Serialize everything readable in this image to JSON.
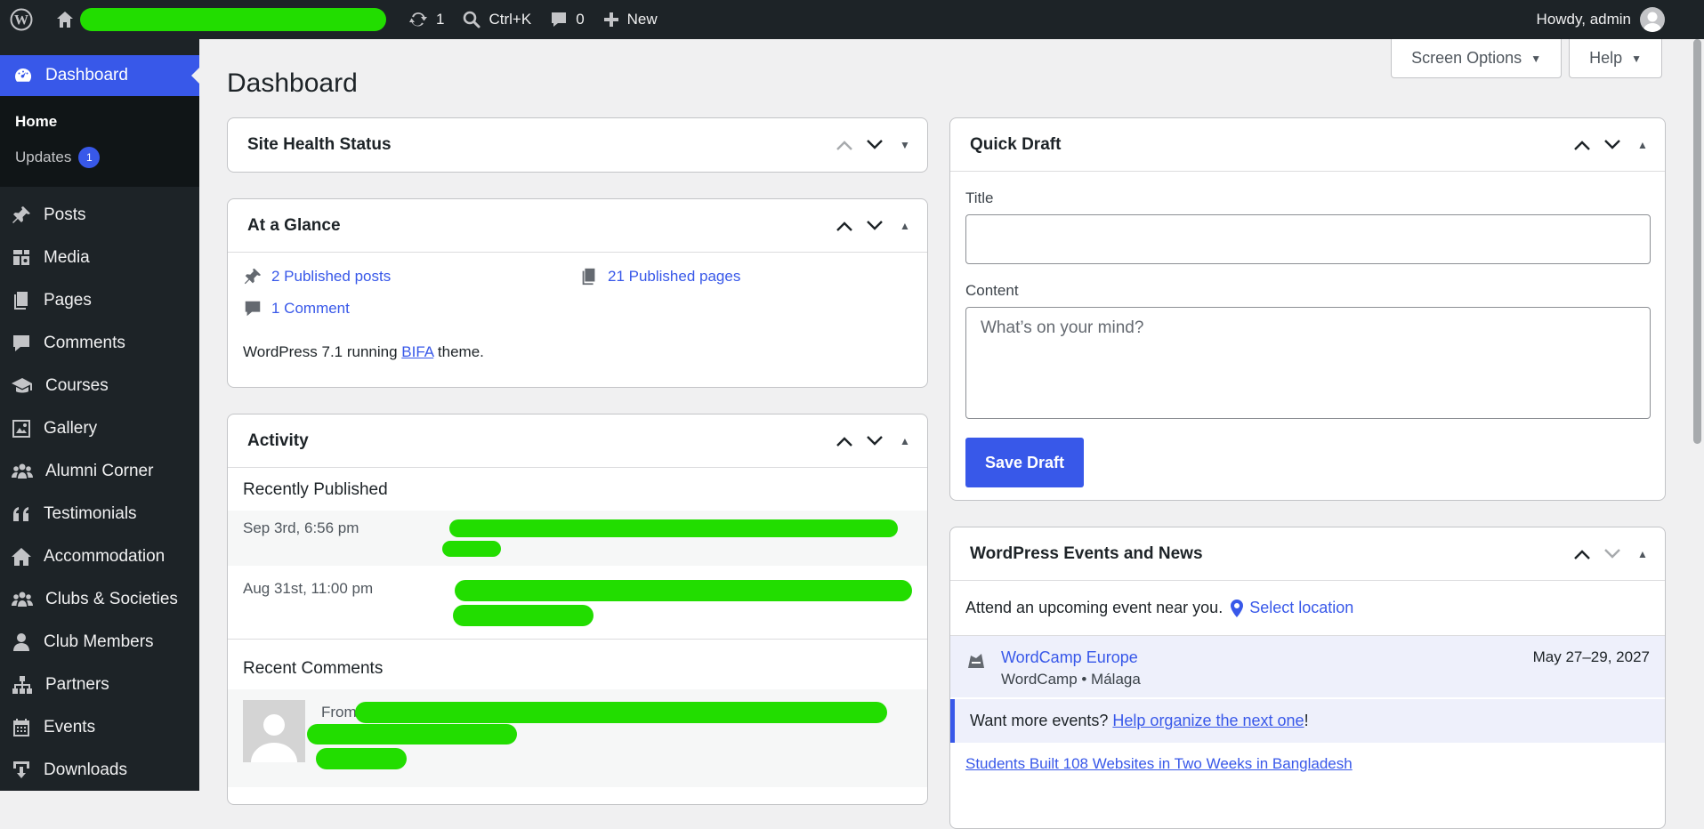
{
  "adminbar": {
    "updates_count": "1",
    "search_label": "Ctrl+K",
    "comments_count": "0",
    "new_label": "New",
    "howdy": "Howdy, admin"
  },
  "sidebar": {
    "dashboard_label": "Dashboard",
    "submenu": {
      "home": "Home",
      "updates": "Updates",
      "updates_count": "1"
    },
    "items": [
      {
        "label": "Posts",
        "icon": "pushpin-icon"
      },
      {
        "label": "Media",
        "icon": "media-icon"
      },
      {
        "label": "Pages",
        "icon": "pages-icon"
      },
      {
        "label": "Comments",
        "icon": "comment-icon"
      },
      {
        "label": "Courses",
        "icon": "graduation-cap-icon"
      },
      {
        "label": "Gallery",
        "icon": "gallery-icon"
      },
      {
        "label": "Alumni Corner",
        "icon": "groups-icon"
      },
      {
        "label": "Testimonials",
        "icon": "quote-icon"
      },
      {
        "label": "Accommodation",
        "icon": "home-icon"
      },
      {
        "label": "Clubs & Societies",
        "icon": "groups-icon"
      },
      {
        "label": "Club Members",
        "icon": "user-icon"
      },
      {
        "label": "Partners",
        "icon": "networking-icon"
      },
      {
        "label": "Events",
        "icon": "calendar-icon"
      },
      {
        "label": "Downloads",
        "icon": "download-icon"
      }
    ]
  },
  "main": {
    "screen_options": "Screen Options",
    "help": "Help",
    "title": "Dashboard"
  },
  "site_health": {
    "title": "Site Health Status"
  },
  "glance": {
    "title": "At a Glance",
    "posts": "2 Published posts",
    "pages": "21 Published pages",
    "comments": "1 Comment",
    "version_prefix": "WordPress 7.1 running ",
    "theme": "BIFA",
    "version_suffix": " theme."
  },
  "activity": {
    "title": "Activity",
    "recently_published": "Recently Published",
    "rows": [
      {
        "date": "Sep 3rd, 6:56 pm"
      },
      {
        "date": "Aug 31st, 11:00 pm"
      }
    ],
    "recent_comments": "Recent Comments",
    "comment_from": "From"
  },
  "quick_draft": {
    "title": "Quick Draft",
    "title_label": "Title",
    "content_label": "Content",
    "content_placeholder": "What’s on your mind?",
    "save_label": "Save Draft"
  },
  "events": {
    "title": "WordPress Events and News",
    "intro": "Attend an upcoming event near you.",
    "select_location": "Select location",
    "event_title": "WordCamp Europe",
    "event_sub": "WordCamp • Málaga",
    "event_date": "May 27–29, 2027",
    "more_prefix": "Want more events? ",
    "more_link": "Help organize the next one",
    "more_suffix": "!",
    "news_link": "Students Built 108 Websites in Two Weeks in Bangladesh"
  },
  "colors": {
    "accent": "#3858e9",
    "redaction": "#22dd00",
    "adminbar": "#1d2327"
  }
}
